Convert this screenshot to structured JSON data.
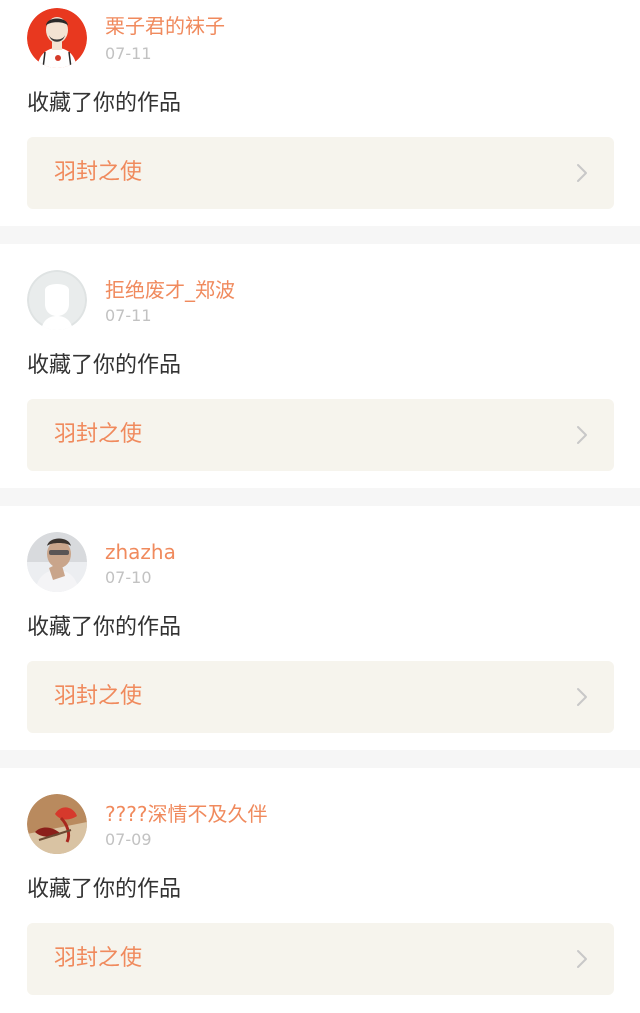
{
  "notifications": [
    {
      "username": "栗子君的袜子",
      "date": "07-11",
      "action": "收藏了你的作品",
      "work_title": "羽封之使"
    },
    {
      "username": "拒绝废才_郑波",
      "date": "07-11",
      "action": "收藏了你的作品",
      "work_title": "羽封之使"
    },
    {
      "username": "zhazha",
      "date": "07-10",
      "action": "收藏了你的作品",
      "work_title": "羽封之使"
    },
    {
      "username": "????深情不及久伴",
      "date": "07-09",
      "action": "收藏了你的作品",
      "work_title": "羽封之使"
    }
  ],
  "colors": {
    "accent": "#f08a5d",
    "muted": "#c2c2c2",
    "text": "#333333",
    "card_link_bg": "#f6f4ed",
    "separator": "#f6f6f6"
  },
  "icons": {
    "chevron": "chevron-right-icon"
  }
}
